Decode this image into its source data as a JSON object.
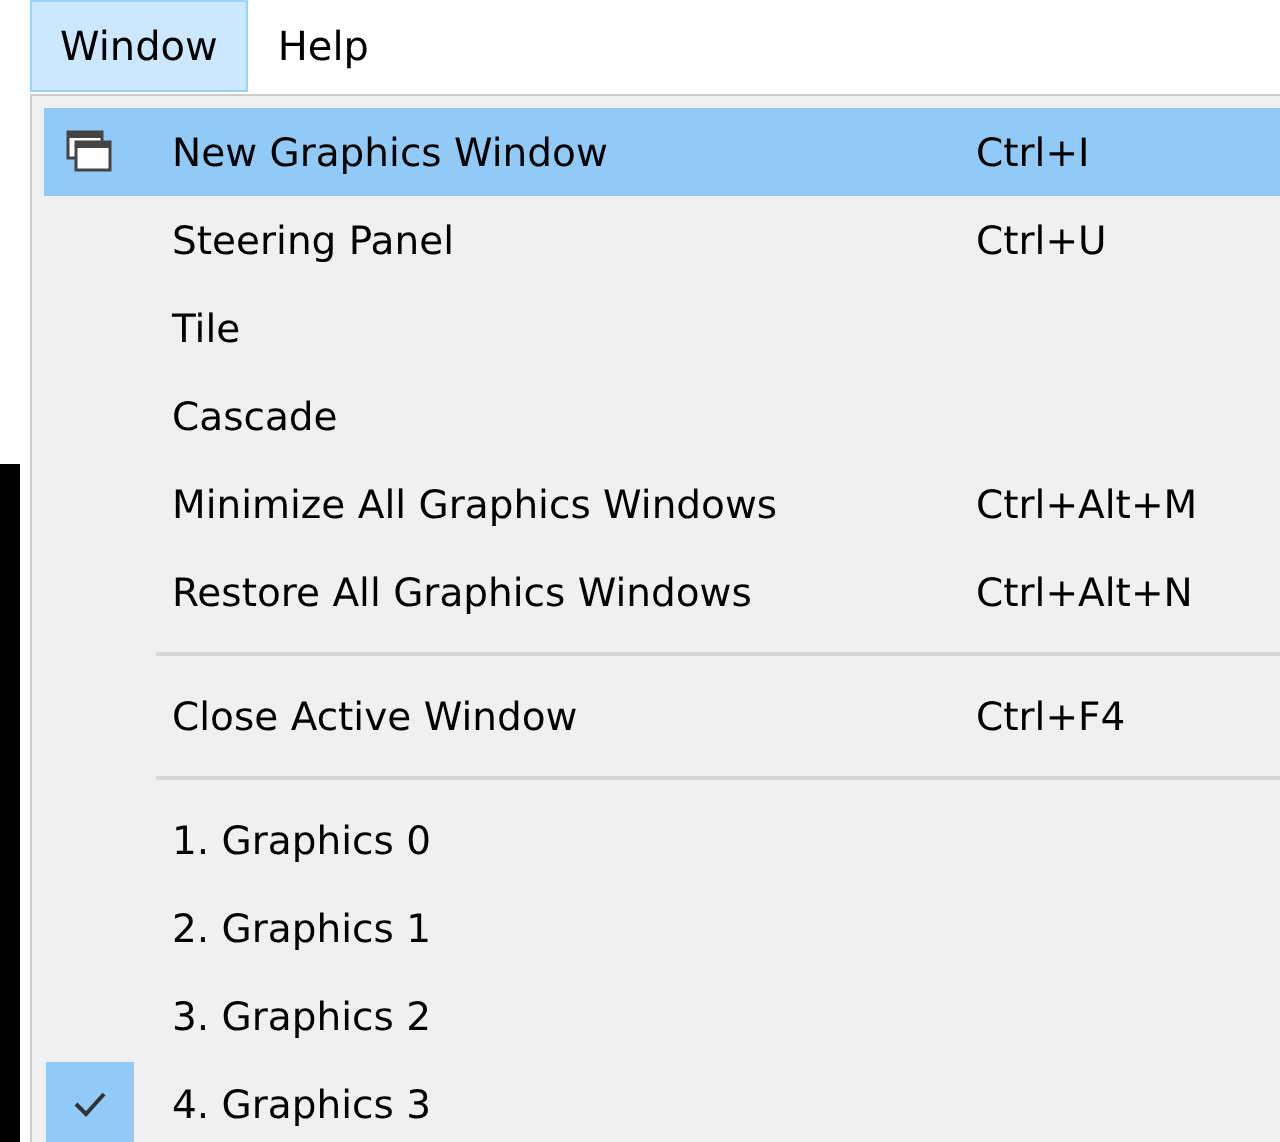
{
  "menubar": [
    {
      "label": "Window",
      "selected": true
    },
    {
      "label": "Help",
      "selected": false
    }
  ],
  "menu": {
    "items": [
      {
        "kind": "item",
        "label": "New Graphics Window",
        "shortcut": "Ctrl+I",
        "icon": true,
        "selected": true,
        "checked": false
      },
      {
        "kind": "item",
        "label": "Steering Panel",
        "shortcut": "Ctrl+U",
        "icon": false,
        "selected": false,
        "checked": false
      },
      {
        "kind": "item",
        "label": "Tile",
        "icon": false,
        "selected": false,
        "checked": false
      },
      {
        "kind": "item",
        "label": "Cascade",
        "icon": false,
        "selected": false,
        "checked": false
      },
      {
        "kind": "item",
        "label": "Minimize All Graphics Windows",
        "shortcut": "Ctrl+Alt+M",
        "icon": false,
        "selected": false,
        "checked": false
      },
      {
        "kind": "item",
        "label": "Restore All Graphics Windows",
        "shortcut": "Ctrl+Alt+N",
        "icon": false,
        "selected": false,
        "checked": false
      },
      {
        "kind": "separator"
      },
      {
        "kind": "item",
        "label": "Close Active Window",
        "shortcut": "Ctrl+F4",
        "icon": false,
        "selected": false,
        "checked": false
      },
      {
        "kind": "separator"
      },
      {
        "kind": "item",
        "label": "1. Graphics 0",
        "icon": false,
        "selected": false,
        "checked": false
      },
      {
        "kind": "item",
        "label": "2. Graphics 1",
        "icon": false,
        "selected": false,
        "checked": false
      },
      {
        "kind": "item",
        "label": "3. Graphics 2",
        "icon": false,
        "selected": false,
        "checked": false
      },
      {
        "kind": "item",
        "label": "4. Graphics 3",
        "icon": false,
        "selected": false,
        "checked": true
      }
    ]
  }
}
